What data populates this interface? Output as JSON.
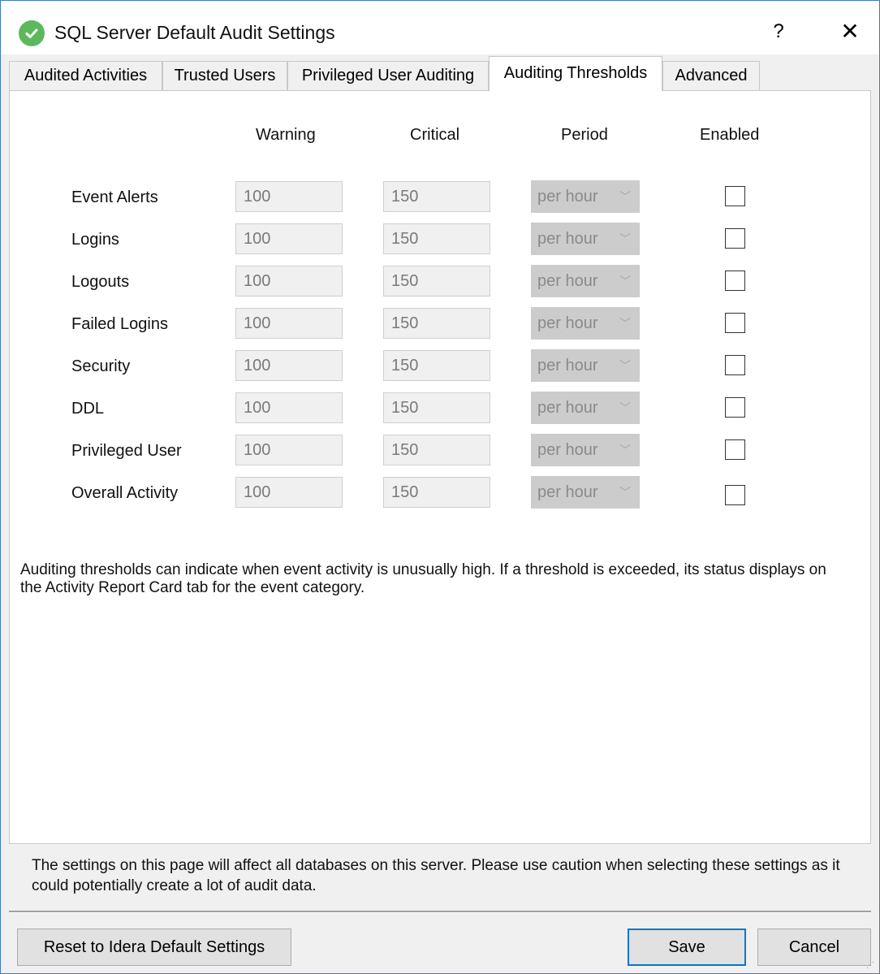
{
  "window": {
    "title": "SQL Server Default Audit Settings",
    "help_label": "?",
    "close_label": "✕",
    "app_icon": "green-check-circle-icon"
  },
  "tabs": [
    {
      "label": "Audited Activities",
      "active": false
    },
    {
      "label": "Trusted Users",
      "active": false
    },
    {
      "label": "Privileged User Auditing",
      "active": false
    },
    {
      "label": "Auditing Thresholds",
      "active": true
    },
    {
      "label": "Advanced",
      "active": false
    }
  ],
  "thresholds": {
    "columns": {
      "warning": "Warning",
      "critical": "Critical",
      "period": "Period",
      "enabled": "Enabled"
    },
    "rows": [
      {
        "label": "Event Alerts",
        "warning": "100",
        "critical": "150",
        "period": "per hour",
        "enabled": false
      },
      {
        "label": "Logins",
        "warning": "100",
        "critical": "150",
        "period": "per hour",
        "enabled": false
      },
      {
        "label": "Logouts",
        "warning": "100",
        "critical": "150",
        "period": "per hour",
        "enabled": false
      },
      {
        "label": "Failed Logins",
        "warning": "100",
        "critical": "150",
        "period": "per hour",
        "enabled": false
      },
      {
        "label": "Security",
        "warning": "100",
        "critical": "150",
        "period": "per hour",
        "enabled": false
      },
      {
        "label": "DDL",
        "warning": "100",
        "critical": "150",
        "period": "per hour",
        "enabled": false
      },
      {
        "label": "Privileged User",
        "warning": "100",
        "critical": "150",
        "period": "per hour",
        "enabled": false
      },
      {
        "label": "Overall Activity",
        "warning": "100",
        "critical": "150",
        "period": "per hour",
        "enabled": false
      }
    ],
    "description": "Auditing thresholds can indicate when event activity is unusually high. If a threshold is exceeded, its status displays on the Activity Report Card tab for the event category."
  },
  "footer": {
    "warning": "The settings on this page will affect all databases on this server. Please use caution when selecting these settings as it could potentially create a lot of audit data.",
    "reset_label": "Reset to Idera Default Settings",
    "save_label": "Save",
    "cancel_label": "Cancel"
  },
  "colors": {
    "accent": "#0078d7",
    "check_green": "#5cb85c",
    "window_border": "#3c78c8"
  }
}
